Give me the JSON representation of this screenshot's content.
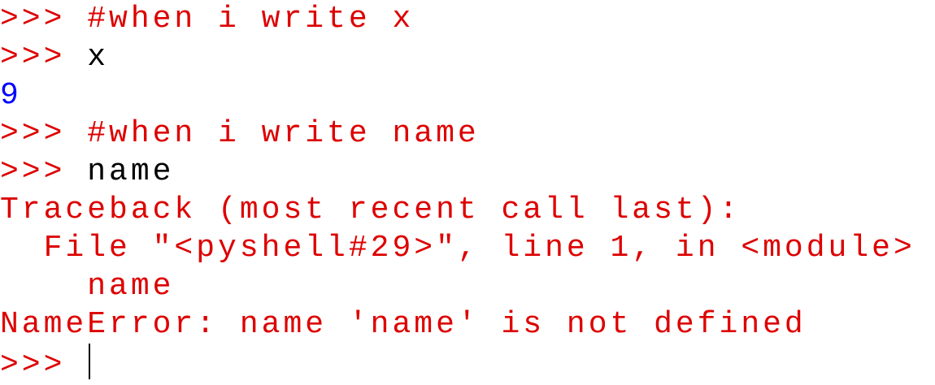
{
  "shell": {
    "lines": [
      {
        "prompt": ">>> ",
        "text": "#when i write x"
      },
      {
        "prompt": ">>> ",
        "text": "x"
      },
      {
        "output": "9"
      },
      {
        "prompt": ">>> ",
        "text": "#when i write name"
      },
      {
        "prompt": ">>> ",
        "text": "name"
      },
      {
        "error": "Traceback (most recent call last):"
      },
      {
        "error": "  File \"<pyshell#29>\", line 1, in <module>"
      },
      {
        "error": "    name"
      },
      {
        "error": "NameError: name 'name' is not defined"
      },
      {
        "prompt": ">>> ",
        "text": ""
      }
    ]
  },
  "colors": {
    "prompt": "#dd0000",
    "comment": "#dd0000",
    "input": "#000000",
    "output": "#0000ff",
    "error": "#dd0000"
  }
}
